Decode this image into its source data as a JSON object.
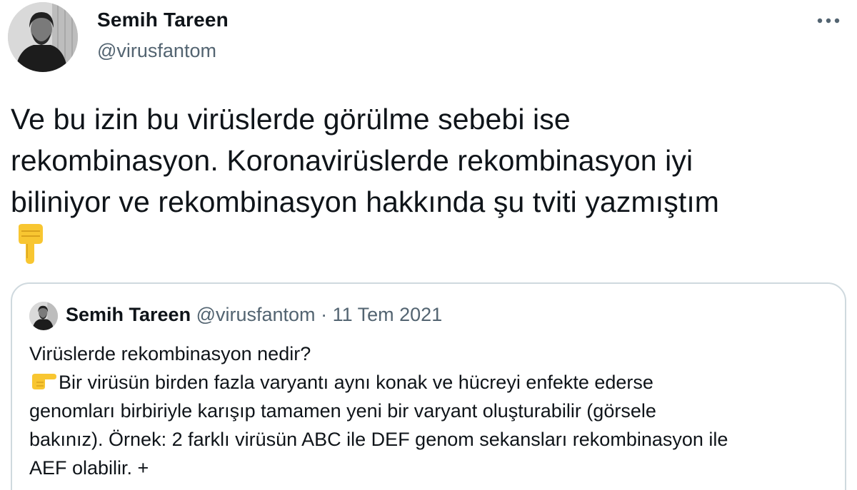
{
  "tweet": {
    "author_name": "Semih Tareen",
    "author_handle": "@virusfantom",
    "more_label": "•••",
    "text_lines": [
      "Ve bu izin bu virüslerde görülme sebebi ise",
      "rekombinasyon. Koronavirüslerde rekombinasyon iyi",
      "biliniyor ve rekombinasyon hakkında şu tviti yazmıştım"
    ],
    "emoji": "pointing-down-icon"
  },
  "quote": {
    "author_name": "Semih Tareen",
    "author_handle": "@virusfantom",
    "separator": "·",
    "date": "11 Tem 2021",
    "lines": [
      "Virüslerde rekombinasyon nedir?",
      "Bir virüsün birden fazla varyantı aynı konak ve hücreyi enfekte ederse",
      "genomları birbiriyle karışıp tamamen yeni bir varyant oluşturabilir (görsele",
      "bakınız). Örnek: 2 farklı virüsün ABC ile DEF genom sekansları rekombinasyon ile",
      "AEF olabilir. +"
    ],
    "line2_emoji": "pointing-right-icon"
  },
  "colors": {
    "text": "#0f1419",
    "secondary": "#536471",
    "border": "#cfd9de",
    "emoji_yellow": "#f8c631"
  }
}
